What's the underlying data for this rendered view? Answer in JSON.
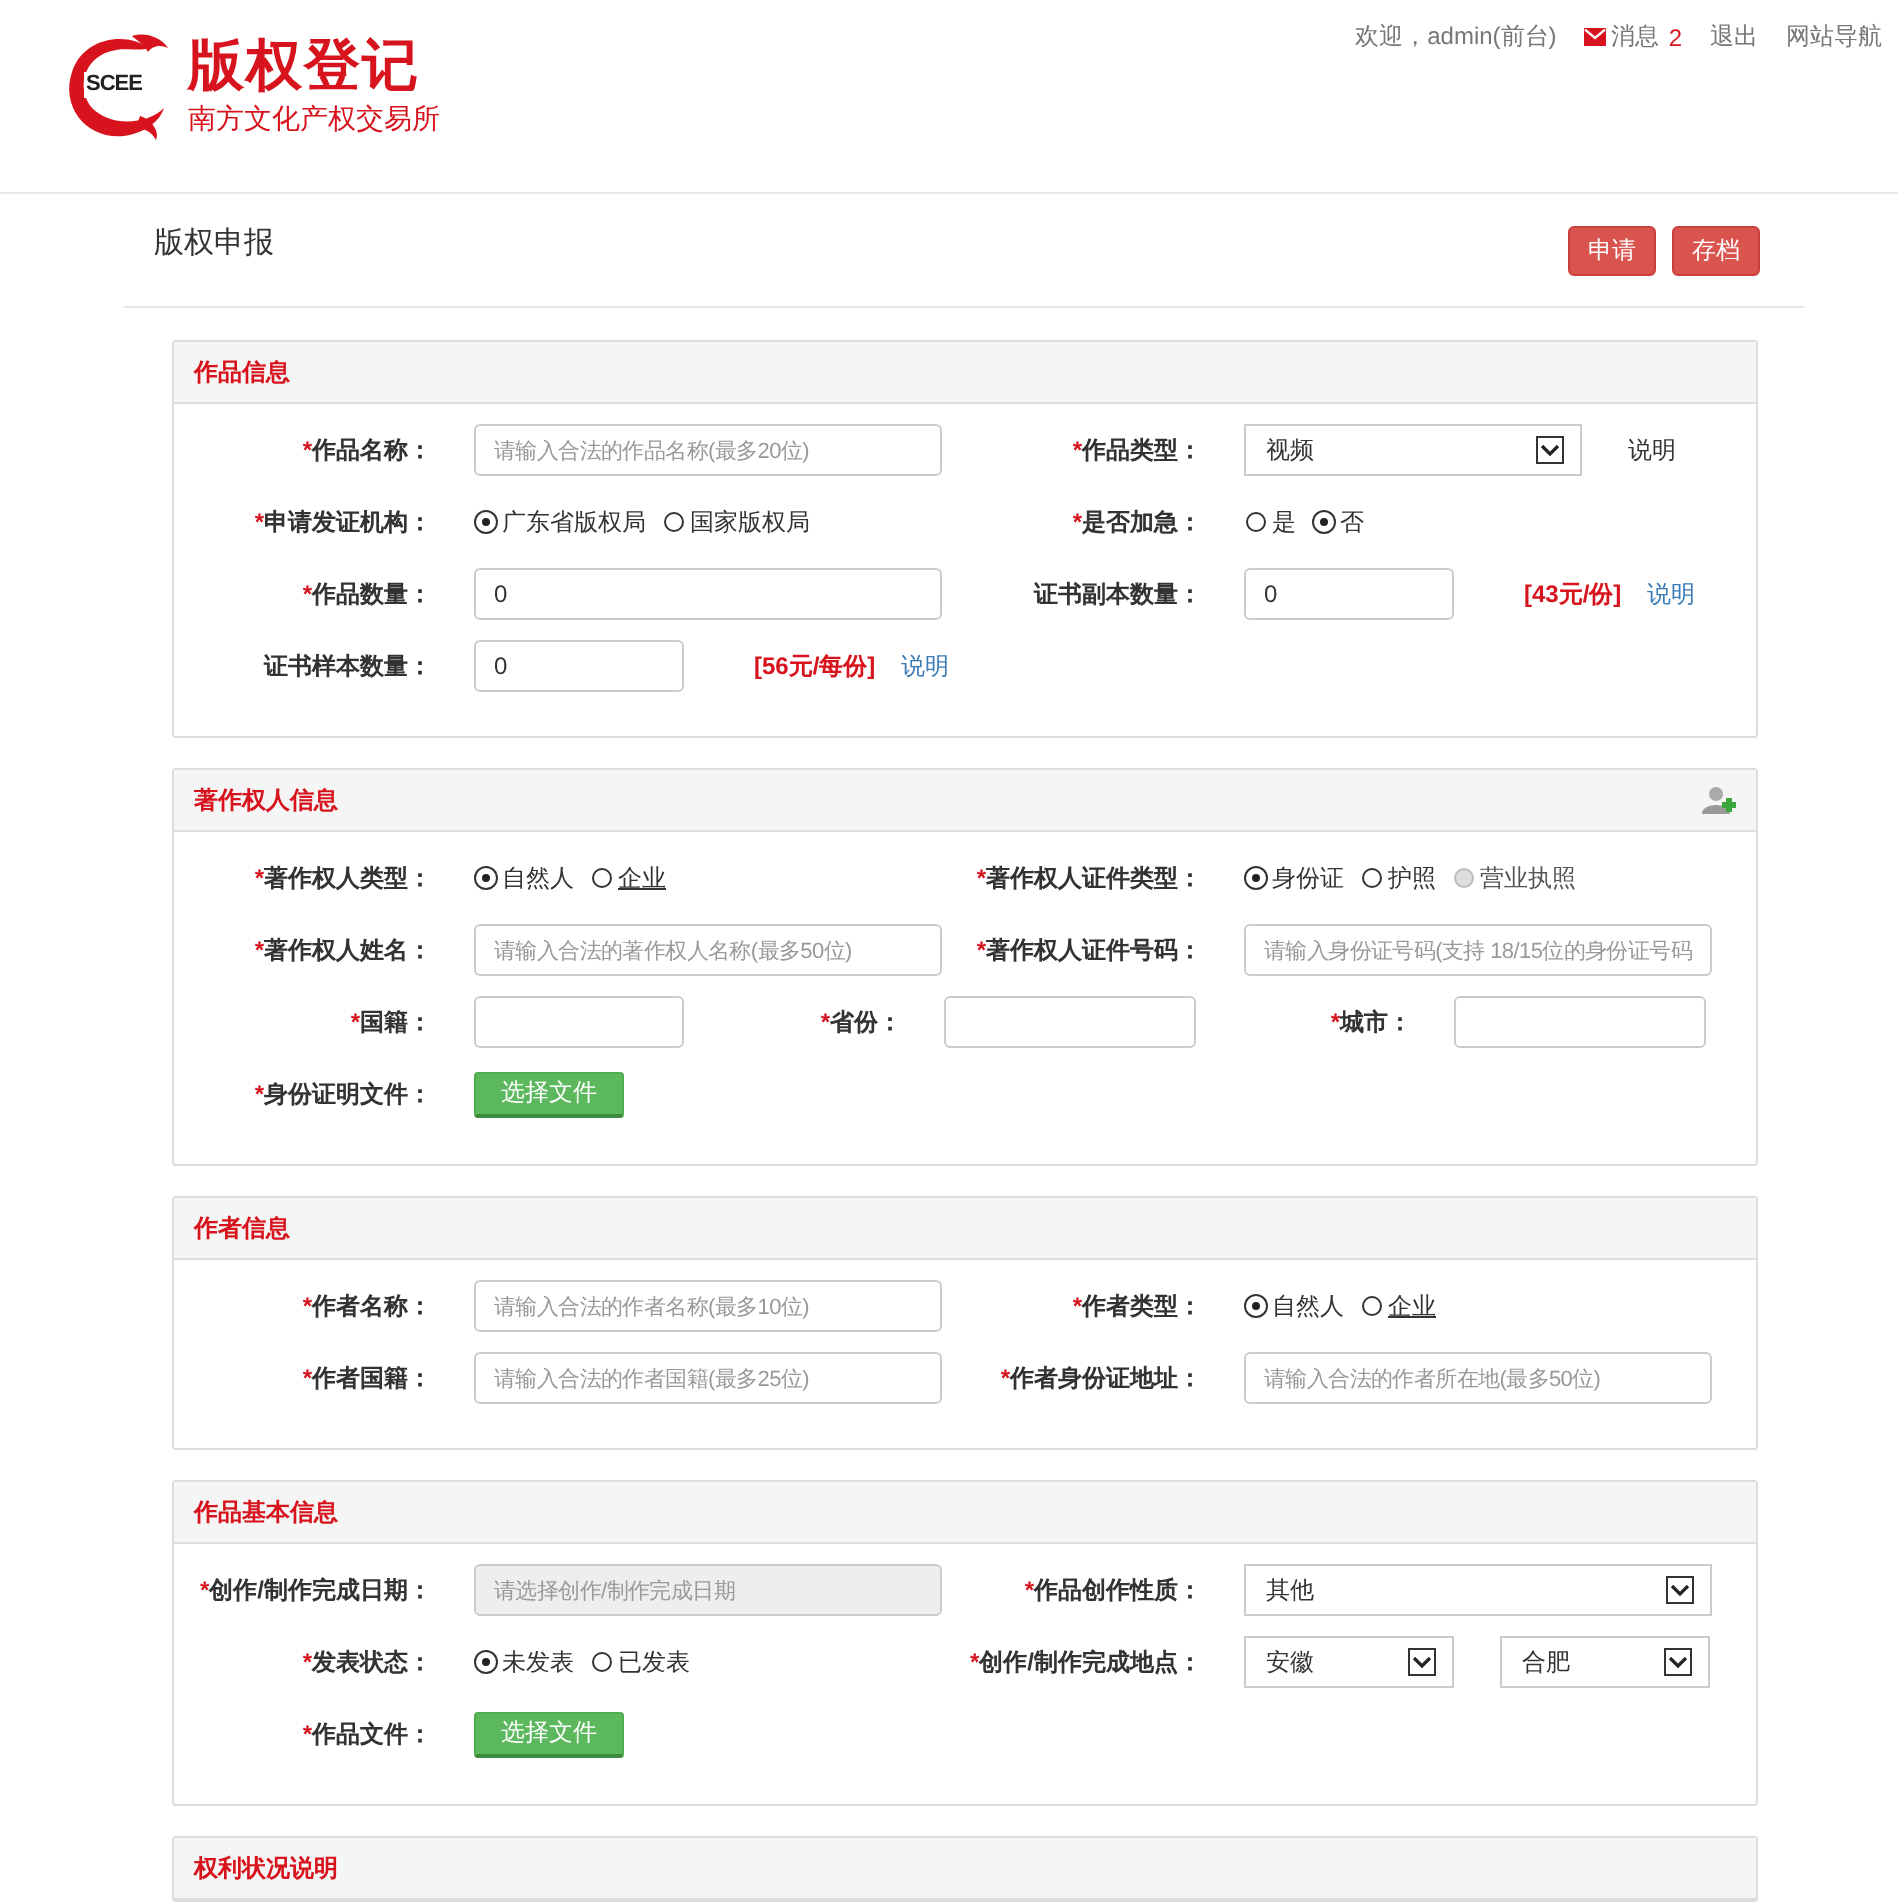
{
  "header": {
    "logo": {
      "mark": "SCEE",
      "title": "版权登记",
      "subtitle": "南方文化产权交易所"
    },
    "user_bar": {
      "welcome": "欢迎，admin(前台)",
      "messages_label": "消息",
      "messages_count": "2",
      "logout": "退出",
      "site_nav": "网站导航"
    }
  },
  "page": {
    "title": "版权申报",
    "actions": [
      "申请",
      "存档"
    ]
  },
  "sections": [
    {
      "title": "作品信息",
      "rows": [
        [
          {
            "mark": "*",
            "label": "作品名称：",
            "controls": [
              {
                "kind": "input",
                "placeholder": "请输入合法的作品名称(最多20位)"
              }
            ]
          },
          {
            "mark": "*",
            "label": "作品类型：",
            "controls": [
              {
                "kind": "select",
                "value": "视频"
              },
              {
                "kind": "note",
                "text": "说明"
              }
            ]
          }
        ],
        [
          {
            "mark": "*",
            "label": "申请发证机构：",
            "controls": [
              {
                "kind": "radio",
                "options": [
                  {
                    "label": "广东省版权局",
                    "selected": true
                  },
                  {
                    "label": "国家版权局",
                    "selected": false
                  }
                ]
              }
            ]
          },
          {
            "mark": "*",
            "label": "是否加急：",
            "controls": [
              {
                "kind": "radio",
                "options": [
                  {
                    "label": "是",
                    "selected": false
                  },
                  {
                    "label": "否",
                    "selected": true
                  }
                ]
              }
            ]
          }
        ],
        [
          {
            "mark": "*",
            "label": "作品数量：",
            "controls": [
              {
                "kind": "input",
                "value": "0"
              }
            ]
          },
          {
            "label": "证书副本数量：",
            "controls": [
              {
                "kind": "input",
                "value": "0"
              },
              {
                "kind": "price",
                "text": "[43元/份]"
              },
              {
                "kind": "link",
                "text": "说明"
              }
            ]
          }
        ],
        [
          {
            "label": "证书样本数量：",
            "controls": [
              {
                "kind": "input",
                "value": "0"
              },
              {
                "kind": "price",
                "text": "[56元/每份]"
              },
              {
                "kind": "link",
                "text": "说明"
              }
            ]
          }
        ]
      ]
    },
    {
      "title": "著作权人信息",
      "addable": true,
      "rows": [
        [
          {
            "mark": "*",
            "label": "著作权人类型：",
            "controls": [
              {
                "kind": "radio",
                "options": [
                  {
                    "label": "自然人",
                    "selected": true,
                    "underlined": false
                  },
                  {
                    "label": "企业",
                    "selected": false,
                    "underlined": true
                  }
                ]
              }
            ]
          },
          {
            "mark": "*",
            "label": "著作权人证件类型：",
            "controls": [
              {
                "kind": "radio",
                "options": [
                  {
                    "label": "身份证",
                    "selected": true,
                    "disabled": false
                  },
                  {
                    "label": "护照",
                    "selected": false,
                    "disabled": false
                  },
                  {
                    "label": "营业执照",
                    "selected": false,
                    "disabled": true
                  }
                ]
              }
            ]
          }
        ],
        [
          {
            "mark": "*",
            "label": "著作权人姓名：",
            "controls": [
              {
                "kind": "input",
                "placeholder": "请输入合法的著作权人名称(最多50位)"
              }
            ]
          },
          {
            "mark": "*",
            "label": "著作权人证件号码：",
            "controls": [
              {
                "kind": "input",
                "placeholder": "请输入身份证号码(支持 18/15位的身份证号码"
              }
            ]
          }
        ],
        [
          {
            "mark": "*",
            "label": "国籍：",
            "controls": [
              {
                "kind": "input"
              }
            ]
          },
          {
            "mark": "*",
            "label": "省份：",
            "controls": [
              {
                "kind": "input"
              }
            ]
          },
          {
            "mark": "*",
            "label": "城市：",
            "controls": [
              {
                "kind": "input"
              }
            ]
          }
        ],
        [
          {
            "mark": "*",
            "label": "身份证明文件：",
            "controls": [
              {
                "kind": "file",
                "text": "选择文件"
              }
            ]
          }
        ]
      ]
    },
    {
      "title": "作者信息",
      "rows": [
        [
          {
            "mark": "*",
            "label": "作者名称：",
            "controls": [
              {
                "kind": "input",
                "placeholder": "请输入合法的作者名称(最多10位)"
              }
            ]
          },
          {
            "mark": "*",
            "label": "作者类型：",
            "controls": [
              {
                "kind": "radio",
                "options": [
                  {
                    "label": "自然人",
                    "selected": true,
                    "underlined": false
                  },
                  {
                    "label": "企业",
                    "selected": false,
                    "underlined": true
                  }
                ]
              }
            ]
          }
        ],
        [
          {
            "mark": "*",
            "label": "作者国籍：",
            "controls": [
              {
                "kind": "input",
                "placeholder": "请输入合法的作者国籍(最多25位)"
              }
            ]
          },
          {
            "mark": "*",
            "label": "作者身份证地址：",
            "controls": [
              {
                "kind": "input",
                "placeholder": "请输入合法的作者所在地(最多50位)"
              }
            ]
          }
        ]
      ]
    },
    {
      "title": "作品基本信息",
      "rows": [
        [
          {
            "mark": "*",
            "label": "创作/制作完成日期：",
            "controls": [
              {
                "kind": "input",
                "disabled": true,
                "placeholder": "请选择创作/制作完成日期"
              }
            ]
          },
          {
            "mark": "*",
            "label": "作品创作性质：",
            "controls": [
              {
                "kind": "select",
                "value": "其他"
              }
            ]
          }
        ],
        [
          {
            "mark": "*",
            "label": "发表状态：",
            "controls": [
              {
                "kind": "radio",
                "options": [
                  {
                    "label": "未发表",
                    "selected": true
                  },
                  {
                    "label": "已发表",
                    "selected": false
                  }
                ]
              }
            ]
          },
          {
            "mark": "*",
            "label": "创作/制作完成地点：",
            "controls": [
              {
                "kind": "select",
                "value": "安徽"
              },
              {
                "kind": "select",
                "value": "合肥"
              }
            ]
          }
        ],
        [
          {
            "mark": "*",
            "label": "作品文件：",
            "controls": [
              {
                "kind": "file",
                "text": "选择文件"
              }
            ]
          }
        ]
      ]
    },
    {
      "title": "权利状况说明"
    }
  ]
}
